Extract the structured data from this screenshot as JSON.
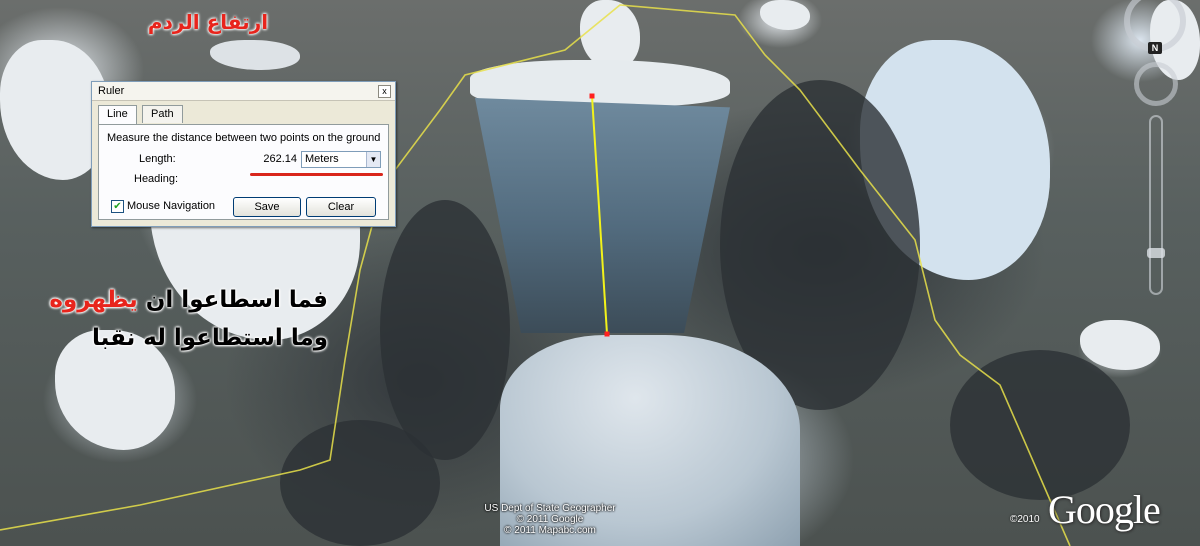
{
  "overlay": {
    "title": "ارتفاع الردم",
    "verse_line1_part1": "فما اسطاعوا ان ",
    "verse_line1_highlight": "يظهروه",
    "verse_line2": "وما استطاعوا له نقبا"
  },
  "ruler_dialog": {
    "window_title": "Ruler",
    "close_glyph": "x",
    "tabs": [
      {
        "label": "Line",
        "active": true
      },
      {
        "label": "Path",
        "active": false
      }
    ],
    "instruction": "Measure the distance between two points on the ground",
    "length_label": "Length:",
    "length_value": "262.14",
    "unit_selected": "Meters",
    "heading_label": "Heading:",
    "heading_value": "",
    "mouse_navigation_label": "Mouse Navigation",
    "mouse_navigation_checked": true,
    "save_label": "Save",
    "clear_label": "Clear"
  },
  "navigation": {
    "compass_label": "N",
    "icons": [
      "look-ring-icon",
      "move-ring-icon",
      "zoom-slider-icon"
    ]
  },
  "attribution": {
    "line1": "US Dept of State Geographer",
    "line2": "© 2011 Google",
    "line3": "© 2011 Mapabc.com",
    "copyright_year": "©2010",
    "brand": "Google"
  },
  "colors": {
    "measure_line": "#f2f21a",
    "boundary_line": "#e8e04a",
    "highlight_text": "#e8241c"
  }
}
